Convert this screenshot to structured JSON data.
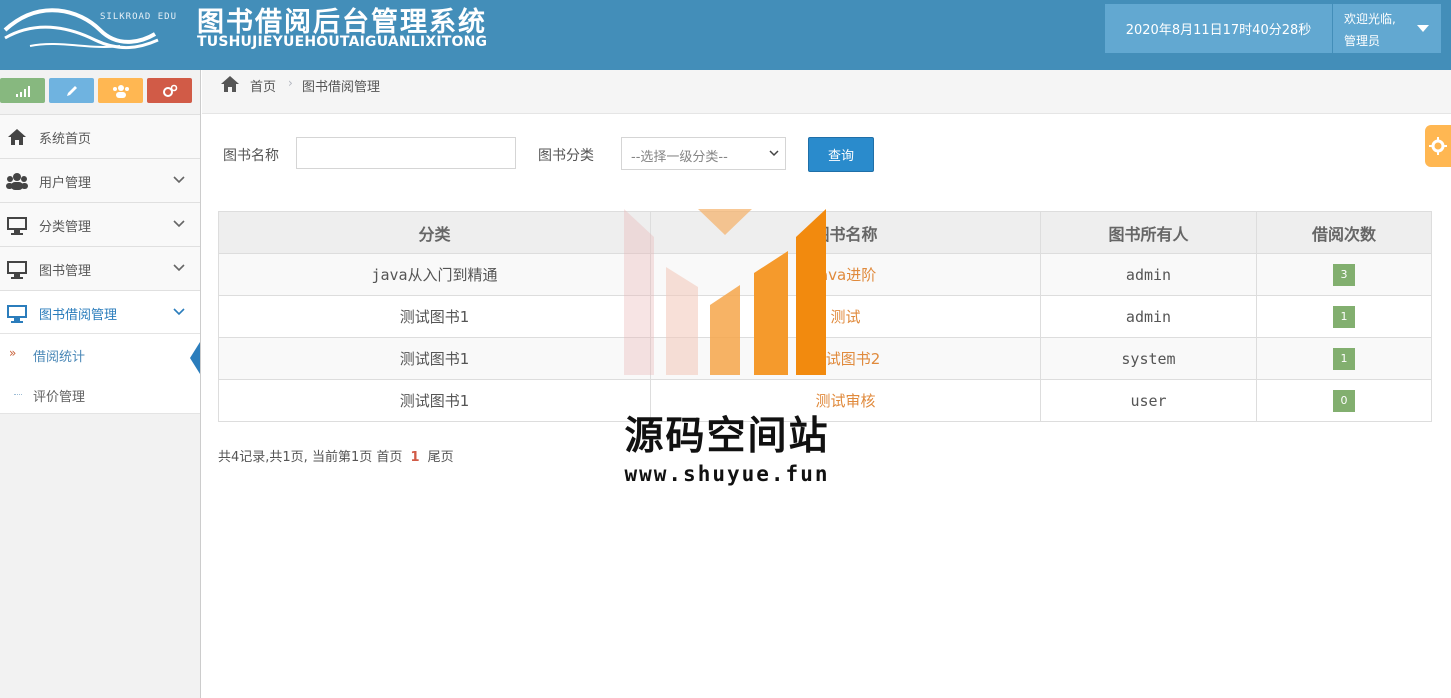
{
  "header": {
    "brand_small": "SILKROAD EDU",
    "title_cn": "图书借阅后台管理系统",
    "title_en": "TUSHUJIEYUEHOUTAIGUANLIXITONG",
    "datetime": "2020年8月11日17时40分28秒",
    "welcome": "欢迎光临,",
    "username": "管理员"
  },
  "sidebar": {
    "shortcut_icons": [
      "signal-icon",
      "pencil-icon",
      "users-icon",
      "cogs-icon"
    ],
    "items": [
      {
        "label": "系统首页",
        "icon": "home-icon"
      },
      {
        "label": "用户管理",
        "icon": "users-icon"
      },
      {
        "label": "分类管理",
        "icon": "desktop-icon"
      },
      {
        "label": "图书管理",
        "icon": "desktop-icon"
      },
      {
        "label": "图书借阅管理",
        "icon": "desktop-icon"
      }
    ],
    "subitems": [
      {
        "label": "借阅统计"
      },
      {
        "label": "评价管理"
      }
    ]
  },
  "breadcrumb": {
    "home": "首页",
    "sep": "›",
    "current": "图书借阅管理"
  },
  "search": {
    "name_label": "图书名称",
    "name_value": "",
    "category_label": "图书分类",
    "category_selected": "--选择一级分类--",
    "query_label": "查询"
  },
  "table": {
    "headers": [
      "分类",
      "图书名称",
      "图书所有人",
      "借阅次数"
    ],
    "rows": [
      {
        "category": "java从入门到精通",
        "book": "java进阶",
        "owner": "admin",
        "count": "3"
      },
      {
        "category": "测试图书1",
        "book": "测试",
        "owner": "admin",
        "count": "1"
      },
      {
        "category": "测试图书1",
        "book": "测试图书2",
        "owner": "system",
        "count": "1"
      },
      {
        "category": "测试图书1",
        "book": "测试审核",
        "owner": "user",
        "count": "0"
      }
    ]
  },
  "pager": {
    "summary": "共4记录,共1页, 当前第1页 首页",
    "current": "1",
    "last": "尾页"
  },
  "watermark": {
    "text": "源码空间站",
    "url": "www.shuyue.fun"
  },
  "colors": {
    "header_bg": "#438eb9",
    "accent": "#2b7dbc",
    "link": "#e08a3c",
    "badge": "#82af6f"
  }
}
